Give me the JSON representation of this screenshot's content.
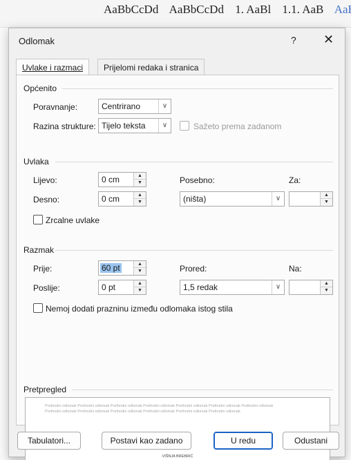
{
  "background": {
    "ribbon_styles": [
      "AaBbCcDd",
      "AaBbCcDd",
      "1. AaBl",
      "1.1. AaB",
      "AaBb"
    ]
  },
  "dialog": {
    "title": "Odlomak",
    "help": "?",
    "close": "✕",
    "tabs": [
      {
        "label": "Uvlake i razmaci",
        "underline": "U"
      },
      {
        "label": "Prijelomi redaka i stranica",
        "underline": "s"
      }
    ],
    "general": {
      "title": "Općenito",
      "alignment_label": "Poravnanje:",
      "alignment_value": "Centrirano",
      "outline_label": "Razina strukture:",
      "outline_value": "Tijelo teksta",
      "collapsed_label": "Sažeto prema zadanom"
    },
    "indent": {
      "title": "Uvlaka",
      "left_label": "Lijevo:",
      "left_value": "0 cm",
      "right_label": "Desno:",
      "right_value": "0 cm",
      "special_label": "Posebno:",
      "special_value": "(ništa)",
      "by_label": "Za:",
      "by_value": "",
      "mirror_label": "Zrcalne uvlake"
    },
    "spacing": {
      "title": "Razmak",
      "before_label": "Prije:",
      "before_value": "60 pt",
      "after_label": "Poslije:",
      "after_value": "0 pt",
      "line_label": "Prored:",
      "line_value": "1,5 redak",
      "at_label": "Na:",
      "at_value": "",
      "dont_add_label": "Nemoj dodati prazninu između odlomaka istog stila"
    },
    "preview": {
      "title": "Pretpregled",
      "sample_text": "Prethodni odlomak Prethodni odlomak Prethodni odlomak Prethodni odlomak Prethodni odlomak Prethodni odlomak Prethodni odlomak Prethodni odlomak Prethodni odlomak Prethodni odlomak Prethodni odlomak Prethodni odlomak Prethodni odlomak",
      "sample_name": "VIŠNJA BREBRIĆ"
    },
    "buttons": {
      "tabs": "Tabulatori...",
      "default": "Postavi kao zadano",
      "ok": "U redu",
      "cancel": "Odustani"
    }
  }
}
